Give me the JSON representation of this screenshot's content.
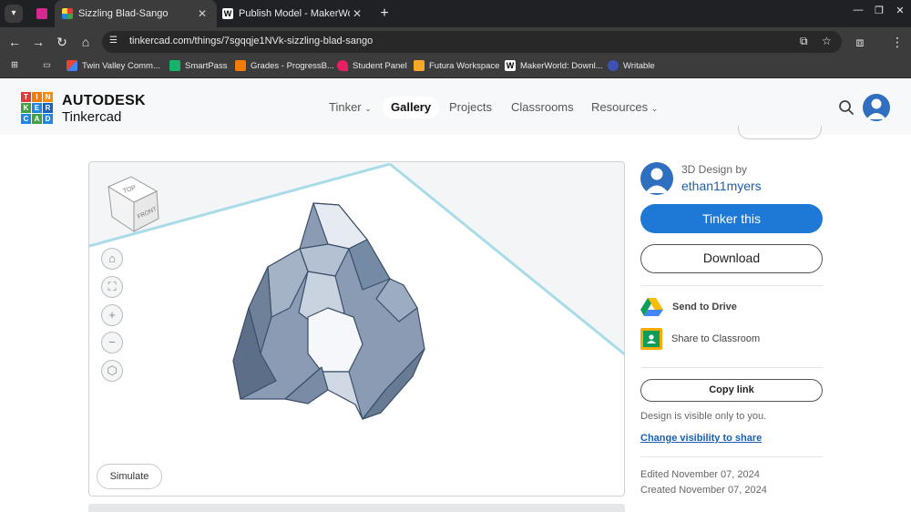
{
  "browser": {
    "tabs": [
      {
        "title": "Sizzling Blad-Sango",
        "active": true
      },
      {
        "title": "Publish Model - MakerWorld",
        "active": false
      }
    ],
    "url": "tinkercad.com/things/7sgqqje1NVk-sizzling-blad-sango",
    "bookmarks": [
      "Twin Valley Comm...",
      "SmartPass",
      "Grades - ProgressB...",
      "Student Panel",
      "Futura Workspace",
      "MakerWorld: Downl...",
      "Writable"
    ]
  },
  "header": {
    "logo_letters": [
      "T",
      "I",
      "N",
      "K",
      "E",
      "R",
      "C",
      "A",
      "D"
    ],
    "brand_line1": "AUTODESK",
    "brand_line2": "Tinkercad",
    "nav": [
      "Tinker",
      "Gallery",
      "Projects",
      "Classrooms",
      "Resources"
    ],
    "active_nav": "Gallery"
  },
  "viewer": {
    "cube_top": "TOP",
    "cube_front": "FRONT",
    "tools": [
      "home-icon",
      "fit-icon",
      "zoom-in-icon",
      "zoom-out-icon",
      "orbit-icon"
    ],
    "simulate_label": "Simulate"
  },
  "sidebar": {
    "design_by": "3D Design by",
    "author": "ethan11myers",
    "tinker_label": "Tinker this",
    "download_label": "Download",
    "send_drive_label": "Send to Drive",
    "share_classroom_label": "Share to Classroom",
    "copy_link_label": "Copy link",
    "visibility_note": "Design is visible only to you.",
    "visibility_link": "Change visibility to share",
    "edited": "Edited November 07, 2024",
    "created": "Created November 07, 2024"
  },
  "colors": {
    "accent": "#1e78d6",
    "link": "#1a5fb4",
    "chrome_dark": "#202124"
  }
}
